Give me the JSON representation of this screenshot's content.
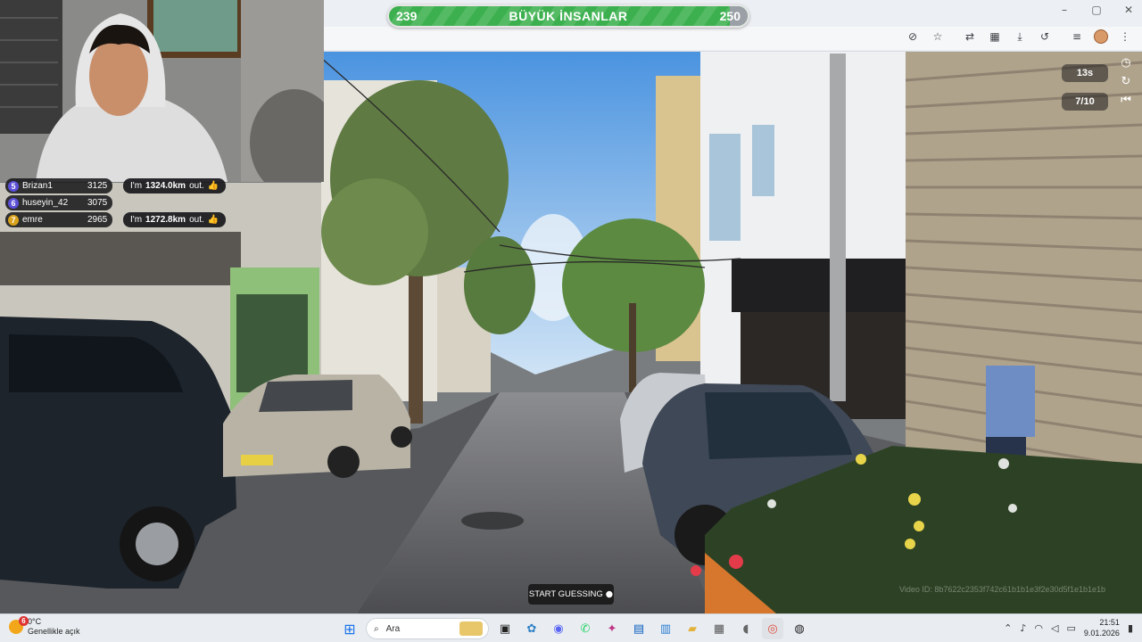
{
  "game": {
    "score_left": "239",
    "score_right": "250",
    "team_title": "BÜYÜK İNSANLAR",
    "timer": "13s",
    "round": "7/10",
    "start_guessing": "START GUESSING",
    "video_id": "Video ID: 8b7622c2353f742c61b1b1e3f2e30d5f1e1b1e1b",
    "bar_fill_fraction": 0.95
  },
  "chat": {
    "rows": [
      {
        "rank": "5",
        "name": "Brizan1",
        "score": "3125",
        "msg_prefix": "I'm",
        "distance": "1324.0km",
        "msg_suffix": "out."
      },
      {
        "rank": "6",
        "name": "huseyin_42",
        "score": "3075",
        "msg_prefix": "",
        "distance": "",
        "msg_suffix": ""
      },
      {
        "rank": "7",
        "name": "emre",
        "score": "2965",
        "msg_prefix": "I'm",
        "distance": "1272.8km",
        "msg_suffix": "out."
      }
    ]
  },
  "taskbar": {
    "temperature": "0°C",
    "weather_desc": "Genellikle açık",
    "weather_badge": "6",
    "search_placeholder": "Ara",
    "time": "21:51",
    "date": "9.01.2026"
  },
  "icons": {
    "window": [
      "minimize-icon",
      "maximize-icon",
      "close-icon"
    ],
    "toolbar": [
      "eye-off-icon",
      "star-icon",
      "translate-icon",
      "apps-icon",
      "download-icon",
      "history-icon",
      "reading-list-icon",
      "profile-icon",
      "menu-icon"
    ]
  }
}
